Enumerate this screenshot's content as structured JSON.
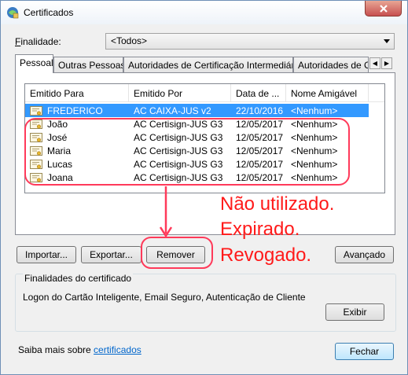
{
  "window": {
    "title": "Certificados"
  },
  "purpose": {
    "label": "Finalidade:",
    "selected": "<Todos>"
  },
  "tabs": [
    "Pessoal",
    "Outras Pessoas",
    "Autoridades de Certificação Intermediárias",
    "Autoridades de Certificação Raiz Confiáveis"
  ],
  "columns": [
    "Emitido Para",
    "Emitido Por",
    "Data de ...",
    "Nome Amigável"
  ],
  "rows": [
    {
      "to": "FREDERICO",
      "by": "AC CAIXA-JUS v2",
      "date": "22/10/2016",
      "name": "<Nenhum>",
      "selected": true
    },
    {
      "to": "João",
      "by": "AC Certisign-JUS G3",
      "date": "12/05/2017",
      "name": "<Nenhum>"
    },
    {
      "to": "José",
      "by": "AC Certisign-JUS G3",
      "date": "12/05/2017",
      "name": "<Nenhum>"
    },
    {
      "to": "Maria",
      "by": "AC Certisign-JUS G3",
      "date": "12/05/2017",
      "name": "<Nenhum>"
    },
    {
      "to": "Lucas",
      "by": "AC Certisign-JUS G3",
      "date": "12/05/2017",
      "name": "<Nenhum>"
    },
    {
      "to": "Joana",
      "by": "AC Certisign-JUS G3",
      "date": "12/05/2017",
      "name": "<Nenhum>"
    }
  ],
  "annotation": {
    "lines": [
      "Não utilizado.",
      "Expirado.",
      "Revogado."
    ],
    "color": "#ff1a1a"
  },
  "buttons": {
    "import": "Importar...",
    "export": "Exportar...",
    "remove": "Remover",
    "advanced": "Avançado",
    "view": "Exibir",
    "close": "Fechar"
  },
  "purposes_group": {
    "title": "Finalidades do certificado",
    "text": "Logon do Cartão Inteligente, Email Seguro, Autenticação de Cliente"
  },
  "footer": {
    "prefix": "Saiba mais sobre ",
    "link": "certificados"
  },
  "icons": {
    "app": "certificate-manager-icon",
    "row": "certificate-icon",
    "close": "close-icon"
  }
}
